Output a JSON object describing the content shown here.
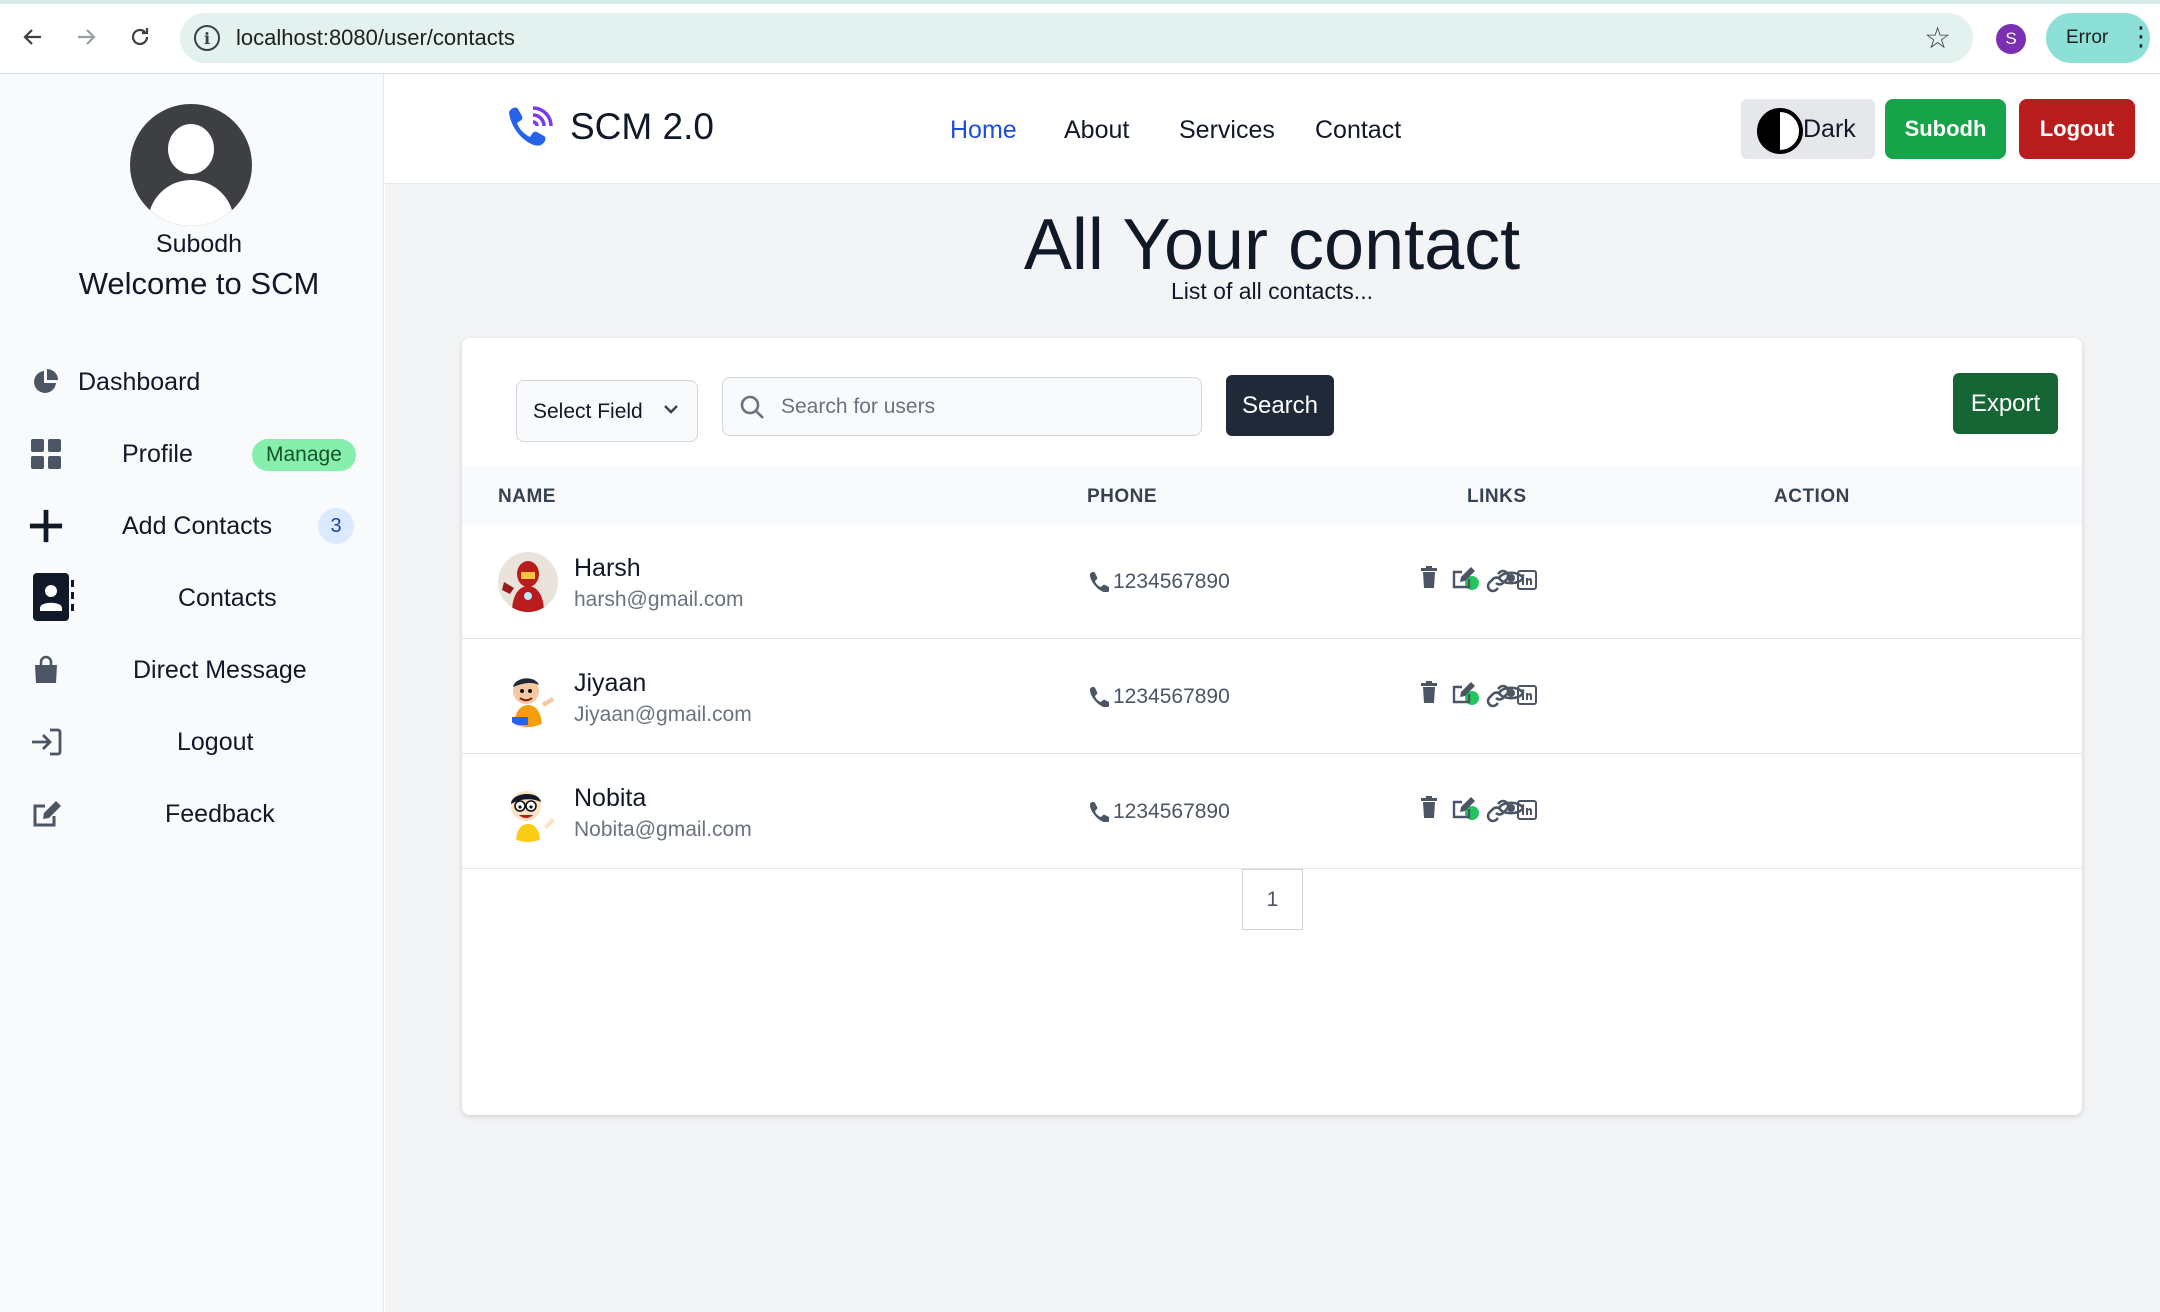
{
  "browser": {
    "url": "localhost:8080/user/contacts",
    "profile_initial": "S",
    "error_label": "Error"
  },
  "sidebar": {
    "username": "Subodh",
    "welcome": "Welcome to SCM",
    "items": [
      {
        "label": "Dashboard",
        "icon": "pie-chart-icon"
      },
      {
        "label": "Profile",
        "icon": "grid-icon",
        "badge": "Manage"
      },
      {
        "label": "Add Contacts",
        "icon": "plus-icon",
        "badge": "3"
      },
      {
        "label": "Contacts",
        "icon": "address-book-icon"
      },
      {
        "label": "Direct Message",
        "icon": "bag-icon"
      },
      {
        "label": "Logout",
        "icon": "logout-icon"
      },
      {
        "label": "Feedback",
        "icon": "edit-icon"
      }
    ]
  },
  "navbar": {
    "brand": "SCM 2.0",
    "links": [
      {
        "label": "Home",
        "active": true
      },
      {
        "label": "About"
      },
      {
        "label": "Services"
      },
      {
        "label": "Contact"
      }
    ],
    "theme_label": "Dark",
    "user_label": "Subodh",
    "logout_label": "Logout"
  },
  "main": {
    "title": "All Your contact",
    "subtitle": "List of all contacts...",
    "select_field": "Select Field",
    "search_placeholder": "Search for users",
    "search_label": "Search",
    "export_label": "Export",
    "columns": [
      "NAME",
      "PHONE",
      "LINKS",
      "ACTION"
    ],
    "contacts": [
      {
        "name": "Harsh",
        "email": "harsh@gmail.com",
        "phone": "1234567890"
      },
      {
        "name": "Jiyaan",
        "email": "Jiyaan@gmail.com",
        "phone": "1234567890"
      },
      {
        "name": "Nobita",
        "email": "Nobita@gmail.com",
        "phone": "1234567890"
      }
    ],
    "page": "1"
  },
  "colors": {
    "accent_link": "#1d4ed8",
    "user_button": "#16a34a",
    "logout_button": "#b91c1c",
    "export_button": "#166534",
    "search_button": "#1f2937",
    "status_online": "#22c55e"
  }
}
